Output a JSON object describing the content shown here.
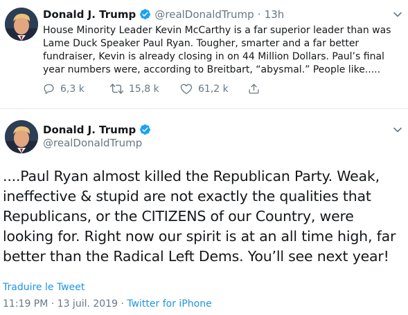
{
  "tweet1": {
    "name": "Donald J. Trump",
    "handle": "@realDonaldTrump",
    "sep": "·",
    "time": "13h",
    "text": "House Minority Leader Kevin McCarthy is a far superior leader than was Lame Duck Speaker Paul Ryan. Tougher, smarter and a far better fundraiser, Kevin is already closing in on 44 Million Dollars. Paul’s final year numbers were, according to Breitbart, “abysmal.” People like.....",
    "replies": "6,3 k",
    "retweets": "15,8 k",
    "likes": "61,2 k"
  },
  "tweet2": {
    "name": "Donald J. Trump",
    "handle": "@realDonaldTrump",
    "text": "....Paul Ryan almost killed the Republican Party. Weak, ineffective & stupid are not exactly the qualities that Republicans, or the CITIZENS of our Country, were looking for. Right now our spirit is at an all time high, far better than the Radical Left Dems. You’ll see next year!",
    "translate": "Traduire le Tweet",
    "timestamp": "11:19 PM · 13 juil. 2019 ·",
    "source": "Twitter for iPhone"
  },
  "colors": {
    "link": "#1b95e0",
    "muted": "#657786",
    "text": "#14171a",
    "verified": "#1da1f2",
    "divider": "#e6ecf0"
  },
  "icons": [
    "verified-badge-icon",
    "chevron-down-icon",
    "reply-icon",
    "retweet-icon",
    "like-icon",
    "share-icon"
  ]
}
